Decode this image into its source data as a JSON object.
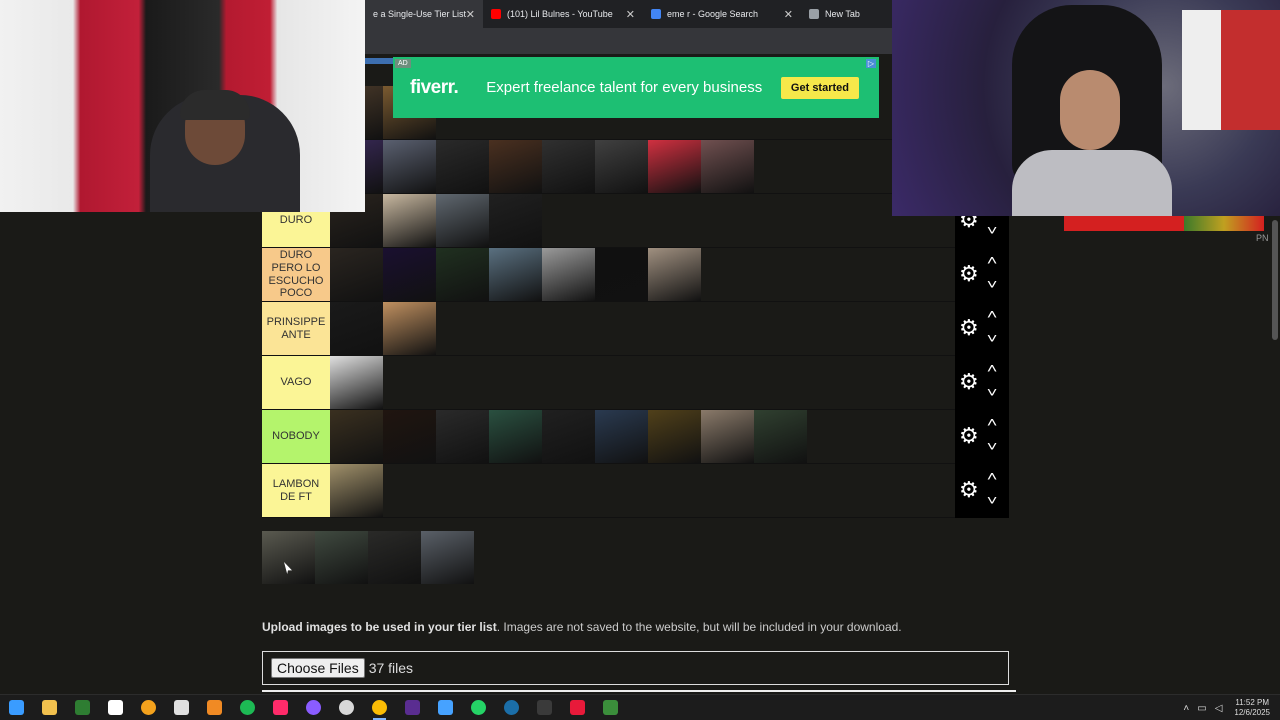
{
  "browser": {
    "tabs": [
      {
        "label": "e a Single-Use Tier List (P",
        "color": "#e44",
        "active": true
      },
      {
        "label": "(101) Lil Bulnes - YouTube",
        "color": "#ff0000",
        "active": false
      },
      {
        "label": "eme r - Google Search",
        "color": "#4285f4",
        "active": false
      },
      {
        "label": "New Tab",
        "color": "#9aa0a6",
        "active": false
      }
    ],
    "close_glyph": "✕"
  },
  "ad": {
    "tag": "AD",
    "brand": "fiverr.",
    "slogan": "Expert freelance talent for every business",
    "cta": "Get started",
    "adchoice": "▷",
    "bg": "#1dbf73"
  },
  "tiers": [
    {
      "label": "",
      "color": "#f0e68c",
      "thumbs": [
        "#4a3a2a",
        "#7a5a30"
      ]
    },
    {
      "label": "",
      "color": "#f7c98a",
      "thumbs": [
        "#3a2a5a",
        "#5a6070",
        "#2a2a2a",
        "#4a3020",
        "#303030",
        "#404040",
        "#d03040",
        "#705050"
      ]
    },
    {
      "label": "DURO",
      "color": "#fbf596",
      "thumbs": [
        "#2a241e",
        "#c8b8a0",
        "#606870",
        "#202020"
      ]
    },
    {
      "label": "DURO PERO LO ESCUCHO POCO",
      "color": "#f7c98a",
      "thumbs": [
        "#2a2520",
        "#1a1030",
        "#203020",
        "#5a7080",
        "#9a9a9a",
        "#101010",
        "#a09080"
      ]
    },
    {
      "label": "PRINSIPPE ANTE",
      "color": "#fbe496",
      "thumbs": [
        "#1a1a1a",
        "#c09060"
      ]
    },
    {
      "label": "VAGO",
      "color": "#fbf596",
      "thumbs": [
        "#e0e0e0"
      ]
    },
    {
      "label": "NOBODY",
      "color": "#b4f46c",
      "thumbs": [
        "#3a3020",
        "#201510",
        "#2a2a2a",
        "#2a5040",
        "#202020",
        "#2a3a50",
        "#50401a",
        "#8a7a6a",
        "#304030"
      ]
    },
    {
      "label": "LAMBON DE FT",
      "color": "#fbf596",
      "thumbs": [
        "#a0906a"
      ]
    }
  ],
  "pool": {
    "thumbs": [
      "#5a5a50",
      "#404a40",
      "#2a2a28",
      "#5a6068"
    ]
  },
  "upload": {
    "bold": "Upload images to be used in your tier list",
    "rest": ". Images are not saved to the website, but will be included in your download.",
    "button": "Choose Files",
    "count": "37 files"
  },
  "overlay": {
    "pn": "PN"
  },
  "taskbar": {
    "icons": [
      {
        "name": "windows-start-icon",
        "color": "#3a9cff",
        "glyph": "⊞"
      },
      {
        "name": "file-explorer-icon",
        "color": "#f2c14e"
      },
      {
        "name": "spreadsheet-icon",
        "color": "#2e7d32"
      },
      {
        "name": "capcut-icon",
        "color": "#ffffff"
      },
      {
        "name": "discord-bot-icon",
        "color": "#f4a21d"
      },
      {
        "name": "capcut-alt-icon",
        "color": "#e0e0e0"
      },
      {
        "name": "vlc-icon",
        "color": "#f08a24"
      },
      {
        "name": "spotify-icon",
        "color": "#1db954"
      },
      {
        "name": "tiktok-icon",
        "color": "#ff2b6a"
      },
      {
        "name": "messenger-icon",
        "color": "#8a5cff"
      },
      {
        "name": "obs-icon",
        "color": "#d8d8d8"
      },
      {
        "name": "chrome-icon",
        "color": "#fbbc05",
        "active": true
      },
      {
        "name": "next-icon",
        "color": "#5a2d91"
      },
      {
        "name": "toolbox-icon",
        "color": "#46a2ff"
      },
      {
        "name": "whatsapp-icon",
        "color": "#25d366"
      },
      {
        "name": "steam-icon",
        "color": "#1b6ea8"
      },
      {
        "name": "4k-icon",
        "color": "#3a3a3a"
      },
      {
        "name": "record-icon",
        "color": "#e81a3a"
      },
      {
        "name": "minecraft-icon",
        "color": "#3b8e3b"
      }
    ],
    "time": "11:52 PM",
    "date": "12/6/2025"
  }
}
